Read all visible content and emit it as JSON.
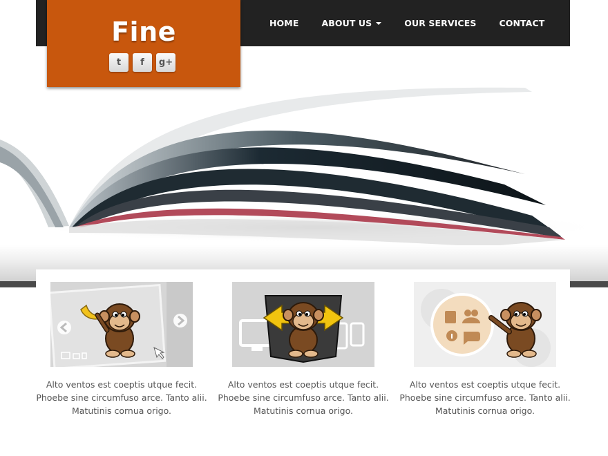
{
  "brand": {
    "name": "Fine"
  },
  "social": [
    {
      "name": "twitter",
      "glyph": "t"
    },
    {
      "name": "facebook",
      "glyph": "f"
    },
    {
      "name": "google-plus",
      "glyph": "g+"
    }
  ],
  "nav": {
    "items": [
      {
        "label": "HOME"
      },
      {
        "label": "ABOUT US",
        "dropdown": true
      },
      {
        "label": "OUR SERVICES"
      },
      {
        "label": "CONTACT"
      }
    ]
  },
  "features": [
    {
      "text": "Alto ventos est coeptis utque fecit. Phoebe sine circumfuso arce. Tanto alii. Matutinis cornua origo.",
      "image": "monkey-slider-illustration"
    },
    {
      "text": "Alto ventos est coeptis utque fecit. Phoebe sine circumfuso arce. Tanto alii. Matutinis cornua origo.",
      "image": "monkey-responsive-devices-illustration"
    },
    {
      "text": "Alto ventos est coeptis utque fecit. Phoebe sine circumfuso arce. Tanto alii. Matutinis cornua origo.",
      "image": "monkey-features-icons-illustration"
    }
  ],
  "colors": {
    "accent": "#c8570d",
    "topbar": "#222222",
    "text": "#555555"
  }
}
